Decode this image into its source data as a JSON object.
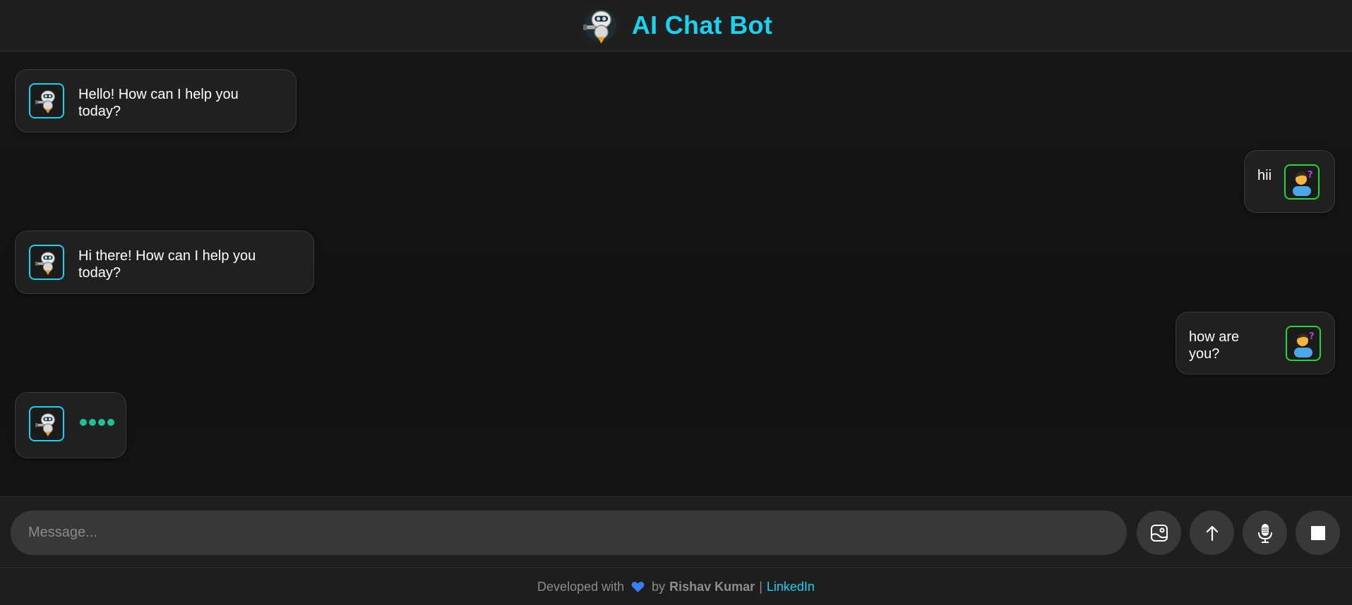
{
  "header": {
    "logo_icon": "robot-logo-icon",
    "title": "AI Chat Bot"
  },
  "messages": [
    {
      "sender": "bot",
      "text": "Hello! How can I help you today?",
      "avatar_icon": "robot-avatar-icon"
    },
    {
      "sender": "user",
      "text": "hii",
      "avatar_icon": "user-question-avatar-icon"
    },
    {
      "sender": "bot",
      "text": "Hi there! How can I help you today?",
      "avatar_icon": "robot-avatar-icon"
    },
    {
      "sender": "user",
      "text": "how are you?",
      "avatar_icon": "user-question-avatar-icon"
    },
    {
      "sender": "bot",
      "typing": true,
      "avatar_icon": "robot-avatar-icon"
    }
  ],
  "input": {
    "placeholder": "Message...",
    "value": ""
  },
  "buttons": {
    "image": "image-upload-icon",
    "send": "arrow-up-icon",
    "mic": "microphone-icon",
    "stop": "stop-icon"
  },
  "footer": {
    "prefix": "Developed with",
    "heart_icon": "blue-heart-icon",
    "by": "by",
    "author": "Rishav Kumar",
    "separator": "|",
    "link_label": "LinkedIn"
  },
  "colors": {
    "accent": "#1ad1f0",
    "user_border": "#22d833",
    "typing_dots": "#1fbf9a",
    "background": "#141414"
  }
}
